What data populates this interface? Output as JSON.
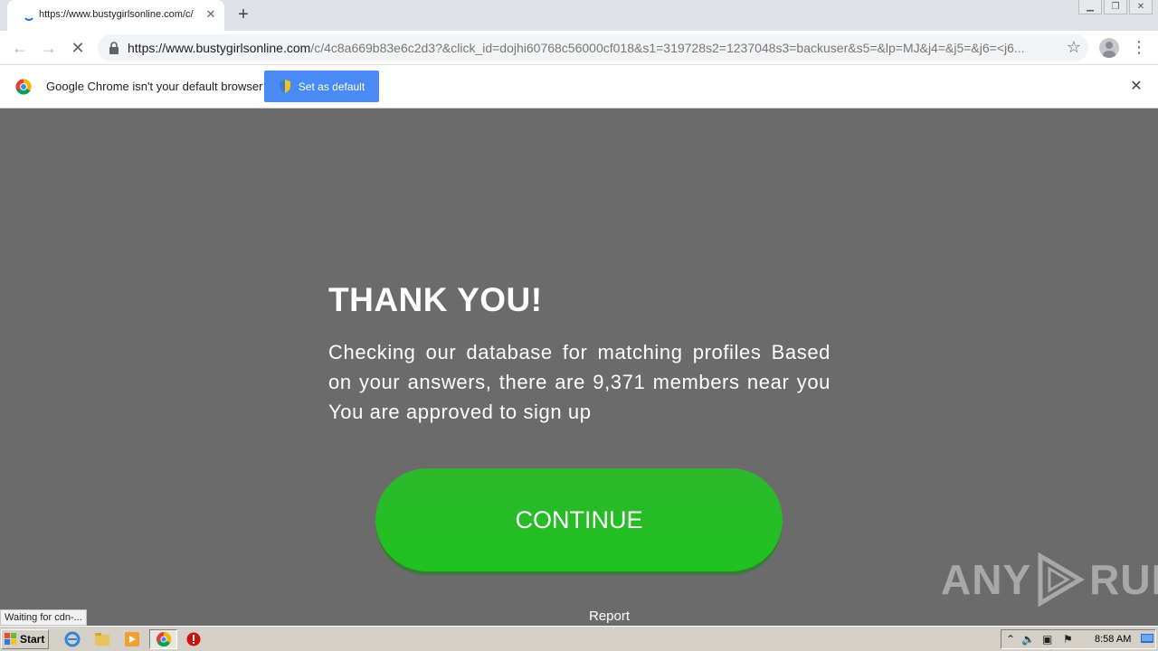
{
  "browser": {
    "tab": {
      "title": "https://www.bustygirlsonline.com/c/"
    },
    "url": {
      "host": "https://www.bustygirlsonline.com",
      "path": "/c/4c8a669b83e6c2d3?&click_id=dojhi60768c56000cf018&s1=319728s2=1237048s3=backuser&s5=&lp=MJ&j4=&j5=&j6=<j6..."
    },
    "infobar": {
      "message": "Google Chrome isn't your default browser",
      "button_label": "Set as default"
    },
    "status_text": "Waiting for cdn-..."
  },
  "page": {
    "heading": "THANK YOU!",
    "body": "Checking our database for matching profiles Based on your answers, there are 9,371 members near you You are approved to sign up",
    "cta_label": "CONTINUE",
    "report_label": "Report",
    "watermark": {
      "left": "ANY",
      "right": "RUN"
    }
  },
  "taskbar": {
    "start_label": "Start",
    "clock": "8:58 AM"
  },
  "colors": {
    "page_background": "#6b6b6b",
    "cta_green": "#22bb22",
    "set_default_blue": "#4a8af4"
  }
}
